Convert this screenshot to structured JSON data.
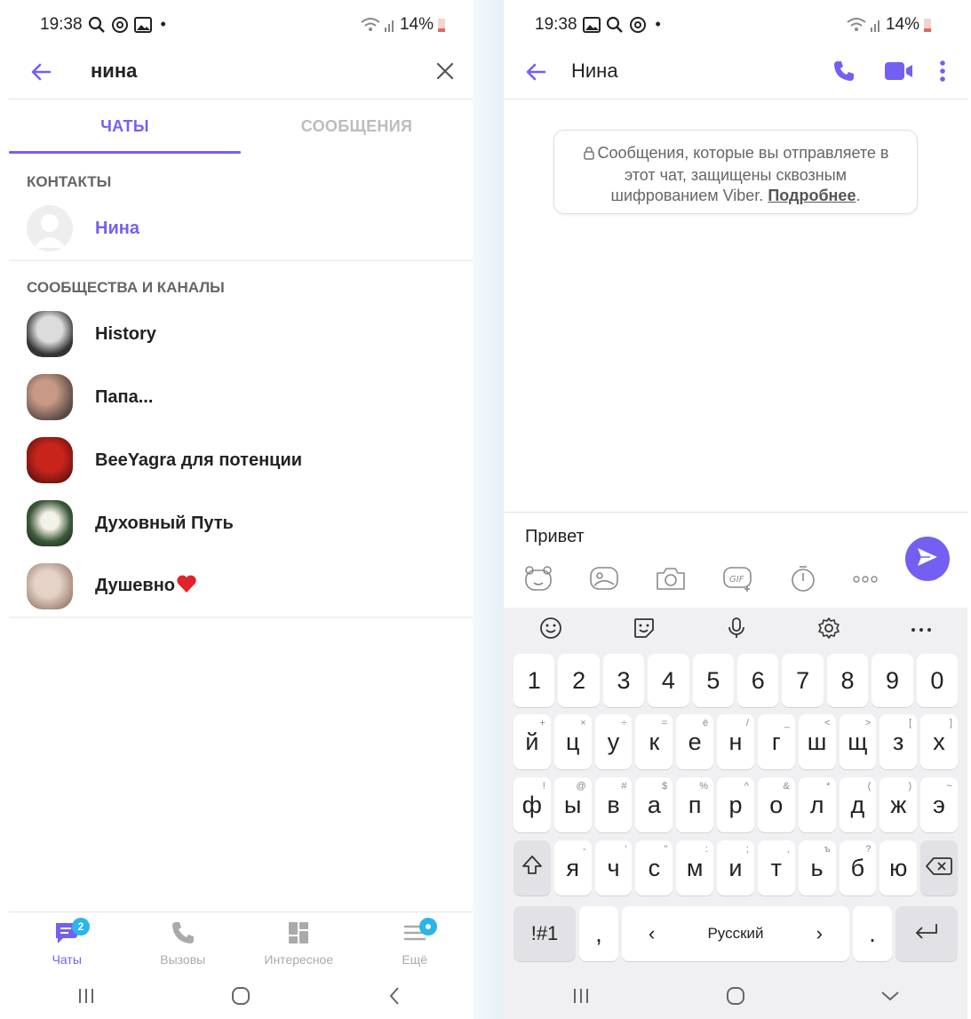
{
  "left_screen": {
    "status": {
      "time": "19:38",
      "battery": "14%"
    },
    "search": {
      "query": "нина"
    },
    "tabs": [
      {
        "label": "ЧАТЫ",
        "active": true
      },
      {
        "label": "СООБЩЕНИЯ",
        "active": false
      }
    ],
    "contacts_header": "КОНТАКТЫ",
    "contacts": [
      {
        "name": "Нина"
      }
    ],
    "communities_header": "СООБЩЕСТВА И КАНАЛЫ",
    "communities": [
      {
        "name": "History"
      },
      {
        "name": "Папа..."
      },
      {
        "name": "BeeYagra для потенции"
      },
      {
        "name": "Духовный Путь"
      },
      {
        "name": "Душевно"
      }
    ],
    "bottom_nav": [
      {
        "label": "Чаты",
        "badge": "2"
      },
      {
        "label": "Вызовы"
      },
      {
        "label": "Интересное"
      },
      {
        "label": "Ещё"
      }
    ]
  },
  "right_screen": {
    "status": {
      "time": "19:38",
      "battery": "14%"
    },
    "chat": {
      "title": "Нина",
      "notice_text": "Сообщения, которые вы отправляете в этот чат, защищены сквозным шифрованием Viber.",
      "notice_link": "Подробнее",
      "notice_end": "."
    },
    "composer": {
      "text": "Привет"
    },
    "keyboard": {
      "numbers": [
        "1",
        "2",
        "3",
        "4",
        "5",
        "6",
        "7",
        "8",
        "9",
        "0"
      ],
      "row1": [
        "й",
        "ц",
        "у",
        "к",
        "е",
        "н",
        "г",
        "ш",
        "щ",
        "з",
        "х"
      ],
      "row1_hints": [
        "+",
        "×",
        "÷",
        "=",
        "ё",
        "/",
        "_",
        "<",
        ">",
        "[",
        "]"
      ],
      "row2": [
        "ф",
        "ы",
        "в",
        "а",
        "п",
        "р",
        "о",
        "л",
        "д",
        "ж",
        "э"
      ],
      "row2_hints": [
        "!",
        "@",
        "#",
        "$",
        "%",
        "^",
        "&",
        "*",
        "(",
        ")",
        "~"
      ],
      "row3": [
        "я",
        "ч",
        "с",
        "м",
        "и",
        "т",
        "ь",
        "б",
        "ю"
      ],
      "row3_hints": [
        "-",
        "'",
        "\"",
        ":",
        ";",
        ",",
        "ъ",
        "?",
        ""
      ],
      "symbols_key": "!#1",
      "comma_key": ",",
      "space_label": "Русский",
      "space_left": "‹",
      "space_right": "›",
      "period_key": "."
    }
  },
  "colors": {
    "accent": "#7360f2",
    "badge": "#2bb5e8"
  }
}
